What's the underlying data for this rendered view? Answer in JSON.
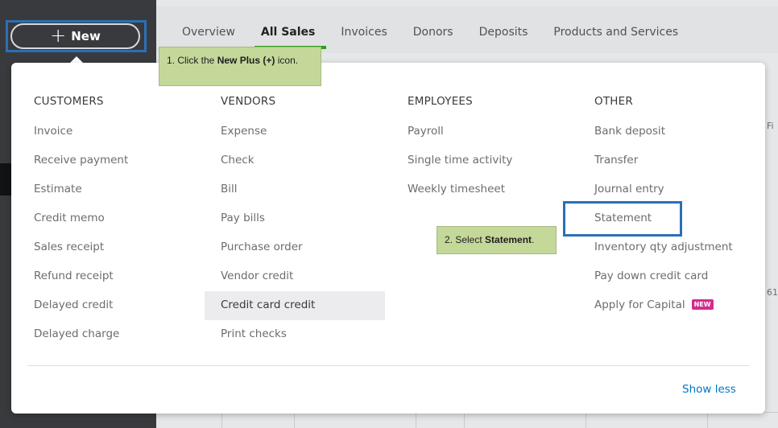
{
  "new_button": {
    "label": "New",
    "plus_glyph": "+"
  },
  "nav_tabs": [
    {
      "label": "Overview",
      "active": false
    },
    {
      "label": "All Sales",
      "active": true
    },
    {
      "label": "Invoices",
      "active": false
    },
    {
      "label": "Donors",
      "active": false
    },
    {
      "label": "Deposits",
      "active": false
    },
    {
      "label": "Products and Services",
      "active": false
    }
  ],
  "background_peek": {
    "right_edge_fragment_1": "Fi",
    "right_edge_fragment_2": "61"
  },
  "menu": {
    "columns": [
      {
        "heading": "CUSTOMERS",
        "items": [
          "Invoice",
          "Receive payment",
          "Estimate",
          "Credit memo",
          "Sales receipt",
          "Refund receipt",
          "Delayed credit",
          "Delayed charge"
        ]
      },
      {
        "heading": "VENDORS",
        "items": [
          "Expense",
          "Check",
          "Bill",
          "Pay bills",
          "Purchase order",
          "Vendor credit",
          "Credit card credit",
          "Print checks"
        ]
      },
      {
        "heading": "EMPLOYEES",
        "items": [
          "Payroll",
          "Single time activity",
          "Weekly timesheet"
        ]
      },
      {
        "heading": "OTHER",
        "items": [
          "Bank deposit",
          "Transfer",
          "Journal entry",
          "Statement",
          "Inventory qty adjustment",
          "Pay down credit card",
          "Apply for Capital"
        ],
        "badge": "NEW"
      }
    ],
    "hovered_item": "Credit card credit",
    "highlighted_item": "Statement",
    "show_less_label": "Show less"
  },
  "callouts": {
    "step1": {
      "prefix": "1. Click the ",
      "bold": "New Plus (+)",
      "suffix": " icon."
    },
    "step2": {
      "prefix": "2. Select ",
      "bold": "Statement",
      "suffix": "."
    }
  },
  "colors": {
    "sidebar": "#393a3d",
    "highlight_border": "#2b6fb6",
    "callout_bg": "#c4d89a",
    "link": "#0077c5",
    "active_tab_underline": "#2ca01c",
    "new_badge": "#d52b8e"
  },
  "icons": {
    "new_button_icon": "plus-icon"
  }
}
